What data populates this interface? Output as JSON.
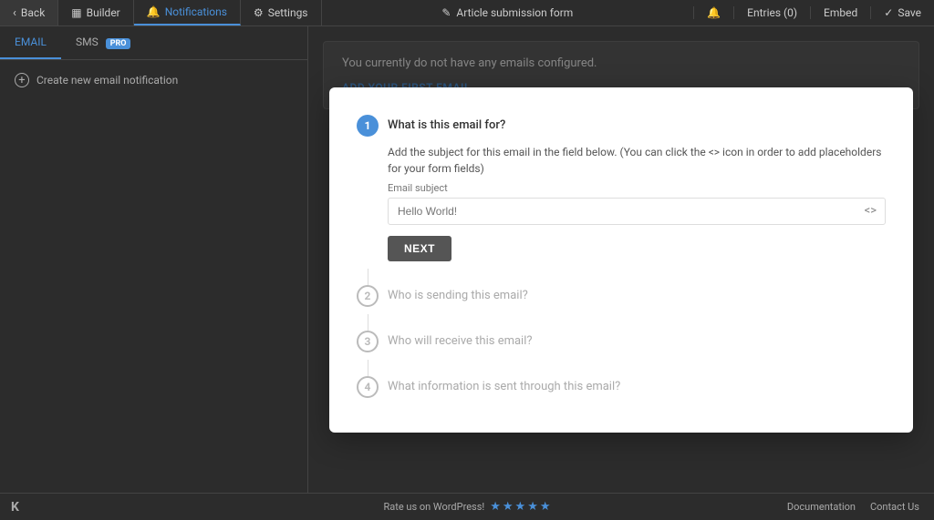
{
  "nav": {
    "back_label": "Back",
    "builder_label": "Builder",
    "notifications_label": "Notifications",
    "settings_label": "Settings",
    "form_title": "Article submission form",
    "entries_label": "Entries (0)",
    "embed_label": "Embed",
    "save_label": "Save"
  },
  "sidebar": {
    "email_tab": "EMAIL",
    "sms_tab": "SMS",
    "pro_badge": "PRO",
    "create_label": "Create new email notification"
  },
  "content": {
    "no_email_text": "You currently do not have any emails configured.",
    "add_email_label": "ADD YOUR FIRST EMAIL"
  },
  "modal": {
    "step1": {
      "number": "1",
      "title": "What is this email for?",
      "description": "Add the subject for this email in the field below. (You can click the <> icon in order to add placeholders for your form fields)",
      "field_label": "Email subject",
      "placeholder": "Hello World!",
      "next_label": "NEXT"
    },
    "step2": {
      "number": "2",
      "title": "Who is sending this email?"
    },
    "step3": {
      "number": "3",
      "title": "Who will receive this email?"
    },
    "step4": {
      "number": "4",
      "title": "What information is sent through this email?"
    }
  },
  "footer": {
    "rate_text": "Rate us on WordPress!",
    "doc_label": "Documentation",
    "contact_label": "Contact Us",
    "logo": "K"
  }
}
